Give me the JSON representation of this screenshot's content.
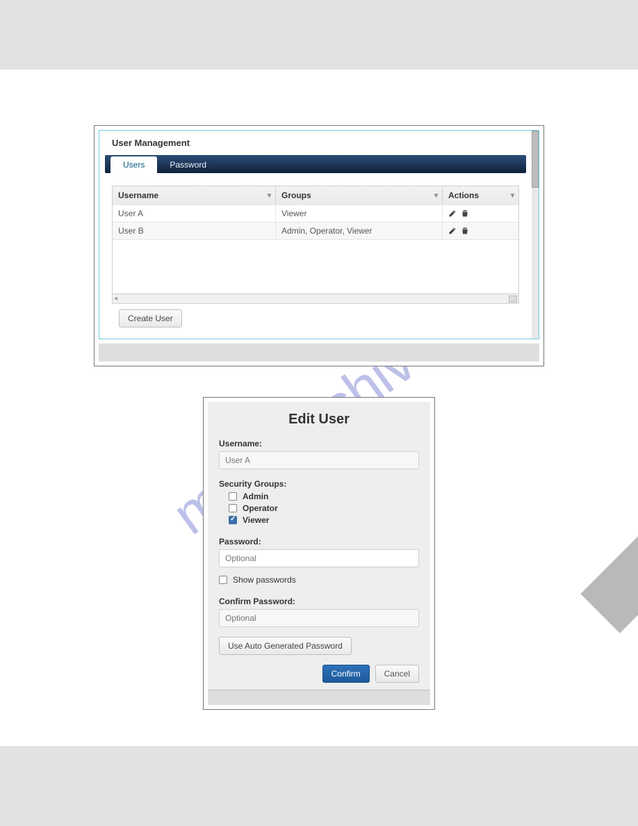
{
  "watermark_text": "manualshive.com",
  "shot1": {
    "panel_title": "User Management",
    "tabs": {
      "users": "Users",
      "password": "Password"
    },
    "headers": {
      "username": "Username",
      "groups": "Groups",
      "actions": "Actions"
    },
    "rows": [
      {
        "username": "User A",
        "groups": "Viewer"
      },
      {
        "username": "User B",
        "groups": "Admin, Operator, Viewer"
      }
    ],
    "create_user_btn": "Create User"
  },
  "shot2": {
    "title": "Edit User",
    "username_label": "Username:",
    "username_value": "User A",
    "security_groups_label": "Security Groups:",
    "groups": {
      "admin": {
        "label": "Admin",
        "checked": false
      },
      "operator": {
        "label": "Operator",
        "checked": false
      },
      "viewer": {
        "label": "Viewer",
        "checked": true
      }
    },
    "password_label": "Password:",
    "password_placeholder": "Optional",
    "show_passwords": {
      "label": "Show passwords",
      "checked": false
    },
    "confirm_label": "Confirm Password:",
    "confirm_placeholder": "Optional",
    "autogen_btn": "Use Auto Generated Password",
    "confirm_btn": "Confirm",
    "cancel_btn": "Cancel"
  }
}
